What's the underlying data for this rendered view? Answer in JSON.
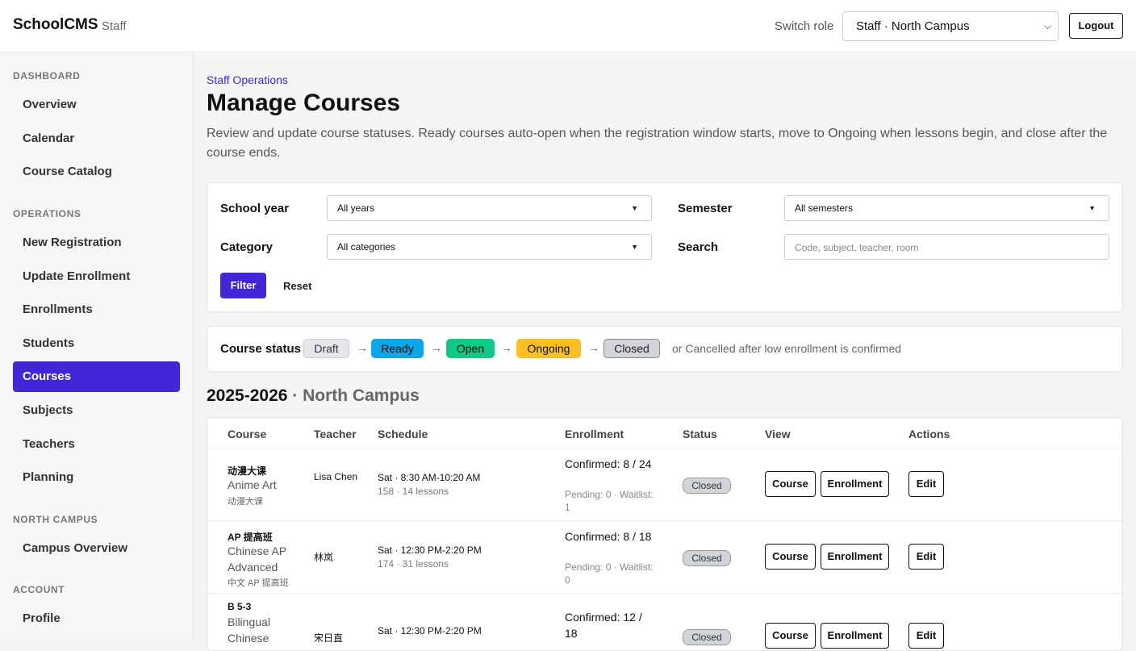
{
  "header": {
    "brand": "SchoolCMS",
    "brand_sub": "Staff",
    "switch_label": "Switch role",
    "role_value": "Staff · North Campus",
    "logout_label": "Logout"
  },
  "sidebar": {
    "sections": [
      "DASHBOARD",
      "OPERATIONS",
      "NORTH CAMPUS",
      "ACCOUNT"
    ],
    "items": [
      {
        "label": "Overview"
      },
      {
        "label": "Calendar"
      },
      {
        "label": "Course Catalog"
      },
      {
        "label": "New Registration"
      },
      {
        "label": "Update Enrollment"
      },
      {
        "label": "Enrollments"
      },
      {
        "label": "Students"
      },
      {
        "label": "Courses",
        "active": true
      },
      {
        "label": "Subjects"
      },
      {
        "label": "Teachers"
      },
      {
        "label": "Planning"
      },
      {
        "label": "Campus Overview"
      },
      {
        "label": "Profile"
      }
    ]
  },
  "page": {
    "breadcrumb": "Staff Operations",
    "title": "Manage Courses",
    "description": "Review and update course statuses. Ready courses auto-open when the registration window starts, move to Ongoing when lessons begin, and close after the course ends."
  },
  "filters": {
    "school_year_label": "School year",
    "school_year_value": "All years",
    "semester_label": "Semester",
    "semester_value": "All semesters",
    "category_label": "Category",
    "category_value": "All categories",
    "search_label": "Search",
    "search_placeholder": "Code, subject, teacher, room",
    "filter_button": "Filter",
    "reset_button": "Reset"
  },
  "status_flow": {
    "label": "Course status",
    "steps": [
      {
        "label": "Draft",
        "color": "#e5e7eb",
        "border": "#c7c9cc",
        "text": "#333333"
      },
      {
        "label": "Ready",
        "color": "#0ea5e9",
        "border": "#0ea5e9",
        "text": "#111111"
      },
      {
        "label": "Open",
        "color": "#10c985",
        "border": "#10c985",
        "text": "#111111"
      },
      {
        "label": "Ongoing",
        "color": "#fbbf24",
        "border": "#fbbf24",
        "text": "#111111"
      },
      {
        "label": "Closed",
        "color": "#d1d5db",
        "border": "#888888",
        "text": "#222222"
      }
    ],
    "note": "or Cancelled after low enrollment is confirmed"
  },
  "section_heading": {
    "year": "2025-2026",
    "campus": " · North Campus"
  },
  "table": {
    "headers": [
      "Course",
      "Teacher",
      "Schedule",
      "Enrollment",
      "Status",
      "View",
      "Actions"
    ],
    "rows": [
      {
        "code": "动漫大课",
        "name": "Anime Art",
        "subname": "动漫大课",
        "teacher": "Lisa Chen",
        "schedule": "Sat · 8:30 AM-10:20 AM",
        "schedule_sub": "158 · 14 lessons",
        "confirmed": "Confirmed: 8 / 24",
        "pending": "Pending: 0 · Waitlist: 1",
        "status": "Closed",
        "view_course": "Course",
        "view_enrollment": "Enrollment",
        "action_edit": "Edit"
      },
      {
        "code": "AP 提高班",
        "name": "Chinese AP Advanced",
        "subname": "中文 AP 提高班",
        "teacher": "林岚",
        "schedule": "Sat · 12:30 PM-2:20 PM",
        "schedule_sub": "174 · 31 lessons",
        "confirmed": "Confirmed: 8 / 18",
        "pending": "Pending: 0 · Waitlist: 0",
        "status": "Closed",
        "view_course": "Course",
        "view_enrollment": "Enrollment",
        "action_edit": "Edit"
      },
      {
        "code": "B 5-3",
        "name": "Bilingual Chinese",
        "subname": "",
        "teacher": "宋日直",
        "schedule": "Sat · 12:30 PM-2:20 PM",
        "schedule_sub": "",
        "confirmed": "Confirmed: 12 / 18",
        "pending": "",
        "status": "Closed",
        "view_course": "Course",
        "view_enrollment": "Enrollment",
        "action_edit": "Edit"
      }
    ]
  }
}
